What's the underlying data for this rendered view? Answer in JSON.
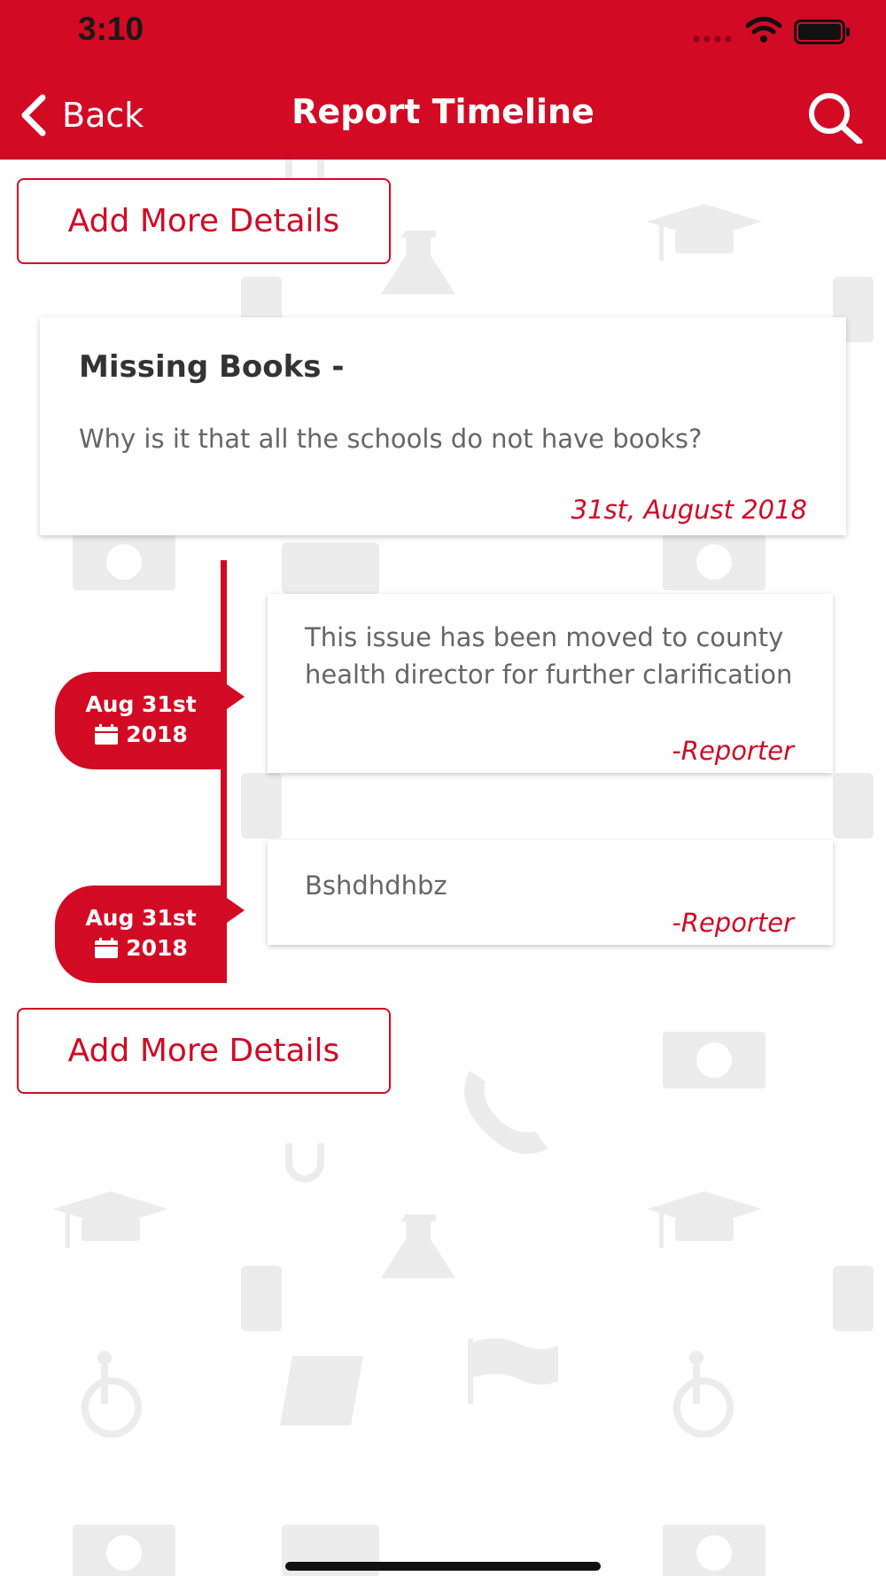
{
  "status_bar": {
    "time": "3:10"
  },
  "nav": {
    "back_label": "Back",
    "title": "Report Timeline",
    "back_icon": "chevron-left-icon",
    "search_icon": "search-icon"
  },
  "actions": {
    "add_more_details_top": "Add More Details",
    "add_more_details_bottom": "Add More Details"
  },
  "report": {
    "title": "Missing Books -",
    "question": "Why is it that all the schools do not have books?",
    "date": "31st, August 2018"
  },
  "timeline": [
    {
      "date_line1": "Aug 31st",
      "date_line2": "2018",
      "text": "This issue has been moved to county health director for further clarification",
      "author": "-Reporter"
    },
    {
      "date_line1": "Aug 31st",
      "date_line2": "2018",
      "text": "Bshdhdhbz",
      "author": "-Reporter"
    }
  ],
  "colors": {
    "brand_red": "#d20a24",
    "text_gray": "#666666",
    "title_dark": "#333333",
    "background_icon_gray": "#ececec"
  }
}
